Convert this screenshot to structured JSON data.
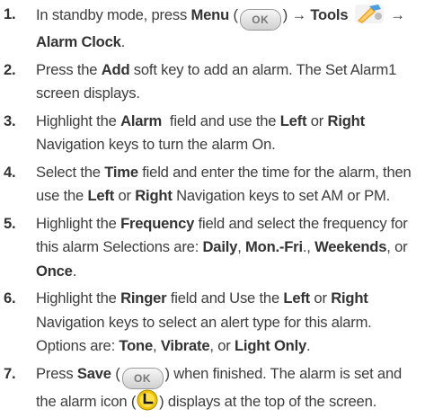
{
  "steps": [
    {
      "num": "1.",
      "t1": "In standby mode, press ",
      "b1": "Menu",
      "t2": " (",
      "ok_label": "OK",
      "t3": ") → ",
      "b2": "Tools",
      "t4": " → ",
      "b3": "Alarm Clock",
      "t5": "."
    },
    {
      "num": "2.",
      "t1": "Press the ",
      "b1": "Add",
      "t2": " soft key to add an alarm. The Set Alarm1 screen displays."
    },
    {
      "num": "3.",
      "t1": "Highlight the ",
      "b1": "Alarm",
      "t2": "  field and use the ",
      "b2": "Left",
      "t3": " or ",
      "b3": "Right",
      "t4": " Navigation keys to turn the alarm On."
    },
    {
      "num": "4.",
      "t1": "Select the ",
      "b1": "Time",
      "t2": " field and enter the time for the alarm, then use the ",
      "b2": "Left",
      "t3": " or ",
      "b3": "Right",
      "t4": " Navigation keys to set AM or PM."
    },
    {
      "num": "5.",
      "t1": "Highlight the ",
      "b1": "Frequency",
      "t2": " field and select the frequency for this alarm Selections are: ",
      "b2": "Daily",
      "t3": ", ",
      "b3": "Mon.-Fri",
      "t4": "., ",
      "b4": "Weekends",
      "t5": ", or ",
      "b5": "Once",
      "t6": "."
    },
    {
      "num": "6.",
      "t1": "Highlight the ",
      "b1": "Ringer",
      "t2": " field and Use the ",
      "b2": "Left",
      "t3": " or ",
      "b3": "Right",
      "t4": " Navigation keys to select an alert type for this alarm. Options are: ",
      "b4": "Tone",
      "t5": ", ",
      "b5": "Vibrate",
      "t6": ", or ",
      "b6": "Light Only",
      "t7": "."
    },
    {
      "num": "7.",
      "t1": "Press ",
      "b1": "Save",
      "t2": " (",
      "ok_label": "OK",
      "t3": ") when finished. The alarm is set and the alarm icon (",
      "t4": ") displays at the top of the screen."
    }
  ],
  "icons": {
    "ok_key": "ok-key-icon",
    "tools": "tools-icon",
    "alarm": "alarm-icon"
  },
  "colors": {
    "text": "#3d3d3d",
    "alarm_icon": "#f2c400",
    "tools_icon": "#f0a020"
  }
}
